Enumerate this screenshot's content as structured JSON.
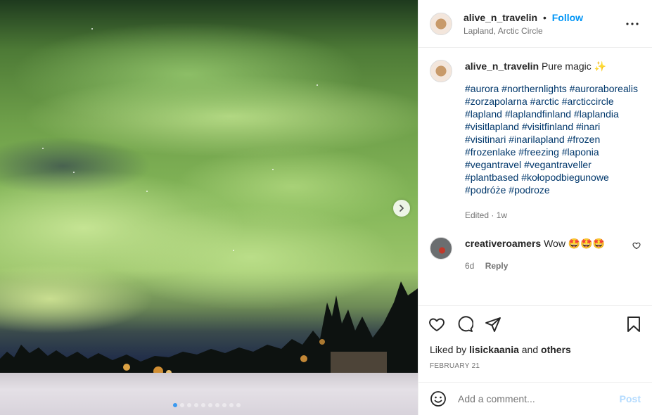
{
  "post": {
    "username": "alive_n_travelin",
    "follow_label": "Follow",
    "separator": "•",
    "location": "Lapland, Arctic Circle",
    "more_icon": "more-horizontal-icon"
  },
  "caption": {
    "username": "alive_n_travelin",
    "text": "Pure magic ✨",
    "hashtags": [
      "#aurora",
      "#northernlights",
      "#auroraborealis",
      "#zorzapolarna",
      "#arctic",
      "#arcticcircle",
      "#lapland",
      "#laplandfinland",
      "#laplandia",
      "#visitlapland",
      "#visitfinland",
      "#inari",
      "#visitinari",
      "#inarilapland",
      "#frozen",
      "#frozenlake",
      "#freezing",
      "#laponia",
      "#vegantravel",
      "#vegantraveller",
      "#plantbased",
      "#kołopodbiegunowe",
      "#podróże",
      "#podroze"
    ],
    "edited": "Edited",
    "time": "1w"
  },
  "comments": [
    {
      "username": "creativeroamers",
      "text": "Wow 🤩🤩🤩",
      "time": "6d",
      "reply_label": "Reply"
    }
  ],
  "actions": {
    "like_icon": "heart-icon",
    "comment_icon": "comment-icon",
    "share_icon": "send-icon",
    "save_icon": "bookmark-icon"
  },
  "likes": {
    "prefix": "Liked by",
    "user": "lisickaania",
    "and": "and",
    "others": "others"
  },
  "date": "FEBRUARY 21",
  "add_comment": {
    "placeholder": "Add a comment...",
    "post_label": "Post"
  },
  "carousel": {
    "slide_count": 10,
    "active_index": 0
  },
  "colors": {
    "link": "#0095f6",
    "hashtag": "#00376b",
    "muted": "#737373"
  }
}
